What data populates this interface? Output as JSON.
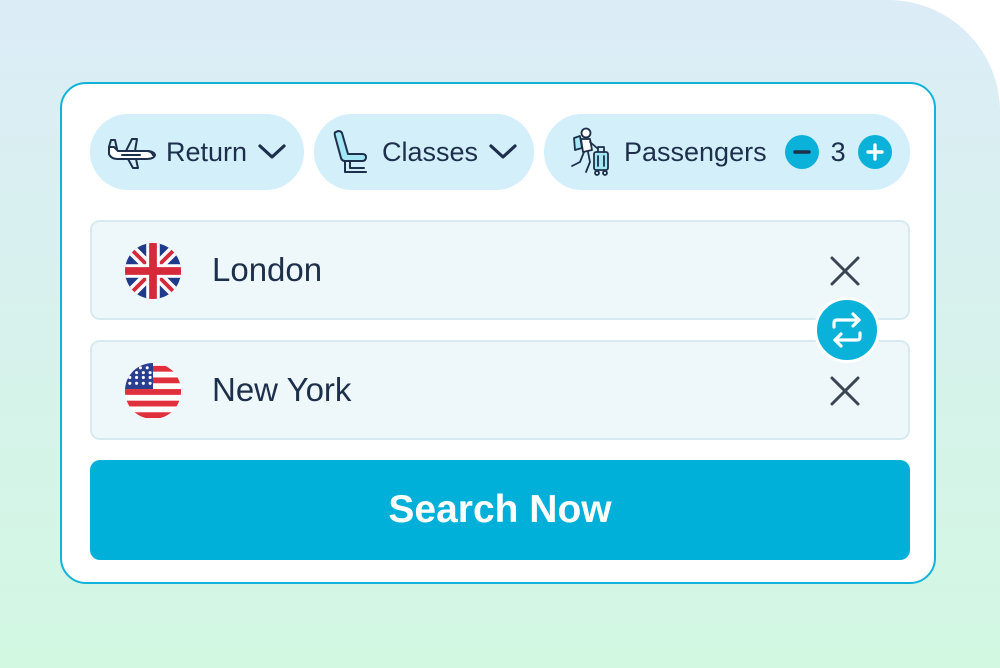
{
  "trip_type": {
    "label": "Return",
    "icon": "airplane-icon"
  },
  "cabin_class": {
    "label": "Classes",
    "icon": "seat-icon"
  },
  "passengers": {
    "label": "Passengers",
    "count": "3",
    "icon": "traveler-icon",
    "decrement_icon": "minus-icon",
    "increment_icon": "plus-icon"
  },
  "origin": {
    "value": "London",
    "flag": "uk-flag-icon"
  },
  "destination": {
    "value": "New York",
    "flag": "us-flag-icon"
  },
  "swap": {
    "icon": "swap-arrows-icon"
  },
  "search_button": {
    "label": "Search Now"
  },
  "colors": {
    "accent": "#00b0d9",
    "pill_bg": "#d2effa",
    "text": "#1d2f4a",
    "field_bg": "#eef8fb"
  }
}
